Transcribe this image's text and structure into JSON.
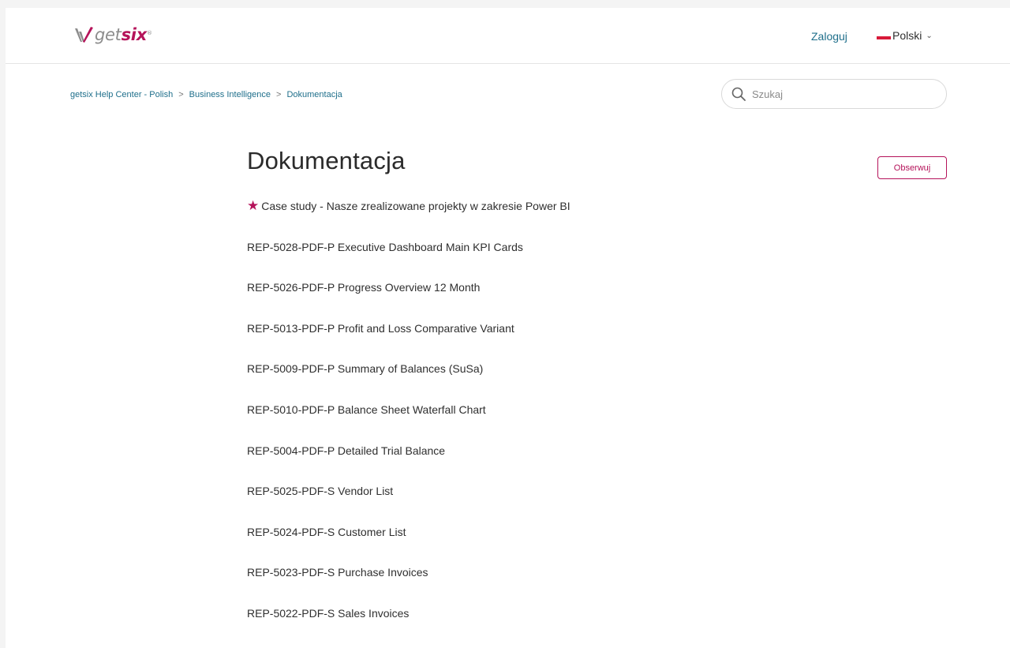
{
  "header": {
    "logo_text_get": "get",
    "logo_text_six": "six",
    "logo_reg": "®",
    "login_label": "Zaloguj",
    "language_label": "Polski",
    "language_chevron": "⌄",
    "flag_color": "#d81a3a"
  },
  "breadcrumb": {
    "items": [
      "getsix Help Center - Polish",
      "Business Intelligence",
      "Dokumentacja"
    ],
    "separator": ">"
  },
  "search": {
    "placeholder": "Szukaj",
    "icon": "search-icon"
  },
  "section": {
    "title": "Dokumentacja",
    "follow_label": "Obserwuj"
  },
  "articles": [
    {
      "title": "Case study - Nasze zrealizowane projekty w zakresie Power BI",
      "promoted": true,
      "icon": "star-icon"
    },
    {
      "title": "REP-5028-PDF-P Executive Dashboard Main KPI Cards"
    },
    {
      "title": "REP-5026-PDF-P Progress Overview 12 Month"
    },
    {
      "title": "REP-5013-PDF-P Profit and Loss Comparative Variant"
    },
    {
      "title": "REP-5009-PDF-P Summary of Balances (SuSa)"
    },
    {
      "title": "REP-5010-PDF-P Balance Sheet Waterfall Chart"
    },
    {
      "title": "REP-5004-PDF-P Detailed Trial Balance"
    },
    {
      "title": "REP-5025-PDF-S Vendor List"
    },
    {
      "title": "REP-5024-PDF-S Customer List"
    },
    {
      "title": "REP-5023-PDF-S Purchase Invoices"
    },
    {
      "title": "REP-5022-PDF-S Sales Invoices"
    }
  ],
  "colors": {
    "brand": "#b5135a",
    "link": "#1f6f8b",
    "text": "#2f2f2f"
  }
}
